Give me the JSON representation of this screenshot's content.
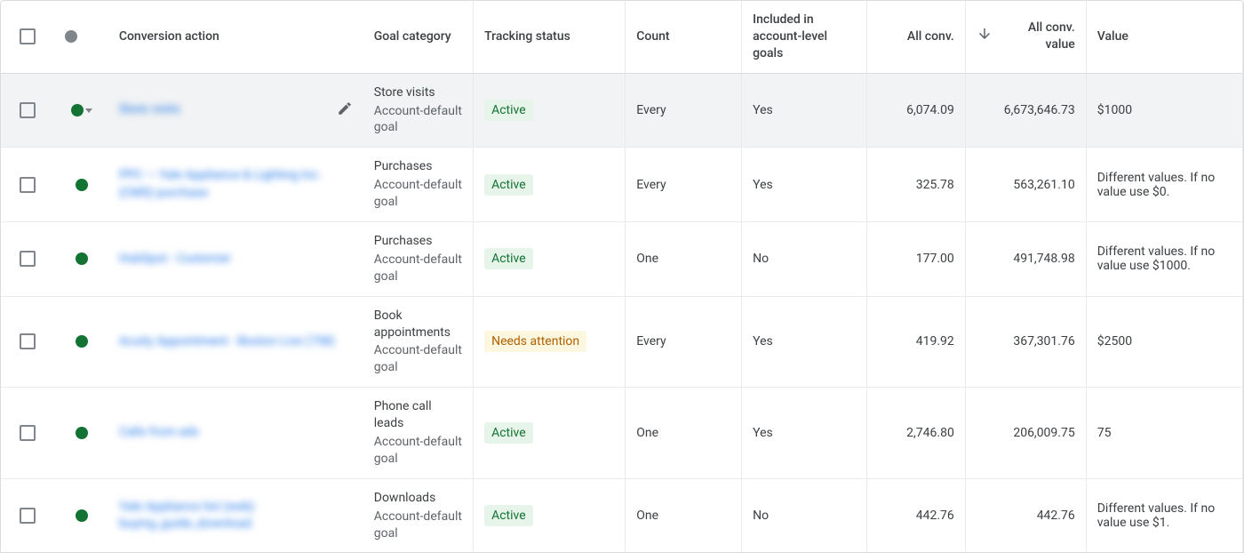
{
  "columns": {
    "conversion_action": "Conversion action",
    "goal_category": "Goal category",
    "tracking_status": "Tracking status",
    "count": "Count",
    "included": "Included in account-level goals",
    "all_conv": "All conv.",
    "all_conv_value": "All conv. value",
    "value": "Value"
  },
  "status_badges": {
    "active": "Active",
    "needs_attention": "Needs attention"
  },
  "rows": [
    {
      "hover": true,
      "status_caret": true,
      "name_blur": "Store visits",
      "show_pencil": true,
      "goal_top": "Store visits",
      "goal_sub": "Account-default goal",
      "tracking": "active",
      "count": "Every",
      "included": "Yes",
      "all_conv": "6,074.09",
      "all_conv_value": "6,673,646.73",
      "value": "$1000"
    },
    {
      "name_blur": "PPC — Yale Appliance & Lighting Inc. (CMS) purchase",
      "goal_top": "Purchases",
      "goal_sub": "Account-default goal",
      "tracking": "active",
      "count": "Every",
      "included": "Yes",
      "all_conv": "325.78",
      "all_conv_value": "563,261.10",
      "value": "Different values. If no value use $0."
    },
    {
      "name_blur": "HubSpot - Customer",
      "goal_top": "Purchases",
      "goal_sub": "Account-default goal",
      "tracking": "active",
      "count": "One",
      "included": "No",
      "all_conv": "177.00",
      "all_conv_value": "491,748.98",
      "value": "Different values. If no value use $1000."
    },
    {
      "name_blur": "Acuity Appointment - Boston Live (758)",
      "goal_top": "Book appointments",
      "goal_sub": "Account-default goal",
      "tracking": "needs_attention",
      "count": "Every",
      "included": "Yes",
      "all_conv": "419.92",
      "all_conv_value": "367,301.76",
      "value": "$2500"
    },
    {
      "name_blur": "Calls from ads",
      "goal_top": "Phone call leads",
      "goal_sub": "Account-default goal",
      "tracking": "active",
      "count": "One",
      "included": "Yes",
      "all_conv": "2,746.80",
      "all_conv_value": "206,009.75",
      "value": "75"
    },
    {
      "name_blur": "Yale Appliance list (web) buying_guide_download",
      "goal_top": "Downloads",
      "goal_sub": "Account-default goal",
      "tracking": "active",
      "count": "One",
      "included": "No",
      "all_conv": "442.76",
      "all_conv_value": "442.76",
      "value": "Different values. If no value use $1."
    }
  ]
}
